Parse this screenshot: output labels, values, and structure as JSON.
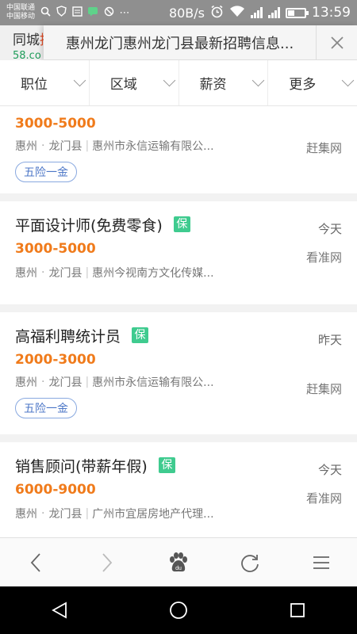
{
  "status_bar": {
    "carrier1": "中国联通",
    "carrier2": "中国移动",
    "speed": "80B/s",
    "signal1_label": "G",
    "signal2_label": "G",
    "time": "13:59"
  },
  "background_page": {
    "title_prefix": "同城",
    "title_highlight": "招聘",
    "subtitle": "58.co"
  },
  "header": {
    "title": "惠州龙门惠州龙门县最新招聘信息...",
    "close_icon": "close-icon"
  },
  "filters": [
    {
      "label": "职位"
    },
    {
      "label": "区域"
    },
    {
      "label": "薪资"
    },
    {
      "label": "更多"
    }
  ],
  "jobs": [
    {
      "title": "",
      "badge": "",
      "date": "",
      "salary": "3000-5000",
      "city": "惠州",
      "district": "龙门县",
      "company": "惠州市永信运输有限公...",
      "source": "赶集网",
      "tag": "五险一金"
    },
    {
      "title": "平面设计师(免费零食)",
      "badge": "保",
      "date": "今天",
      "salary": "3000-5000",
      "city": "惠州",
      "district": "龙门县",
      "company": "惠州今视南方文化传媒...",
      "source": "看准网",
      "tag": ""
    },
    {
      "title": "高福利聘统计员",
      "badge": "保",
      "date": "昨天",
      "salary": "2000-3000",
      "city": "惠州",
      "district": "龙门县",
      "company": "惠州市永信运输有限公...",
      "source": "赶集网",
      "tag": "五险一金"
    },
    {
      "title": "销售顾问(带薪年假)",
      "badge": "保",
      "date": "今天",
      "salary": "6000-9000",
      "city": "惠州",
      "district": "龙门县",
      "company": "广州市宜居房地产代理...",
      "source": "看准网",
      "tag": ""
    }
  ],
  "bottom_nav": [
    "back-icon",
    "forward-icon",
    "baidu-paw-icon",
    "refresh-icon",
    "menu-icon"
  ],
  "system_nav": [
    "android-back-icon",
    "android-home-icon",
    "android-recents-icon"
  ],
  "colors": {
    "salary": "#f07b1b",
    "badge": "#3fcb8f",
    "tag_border": "#89a9e0",
    "status_bar": "#8f8f8f"
  }
}
